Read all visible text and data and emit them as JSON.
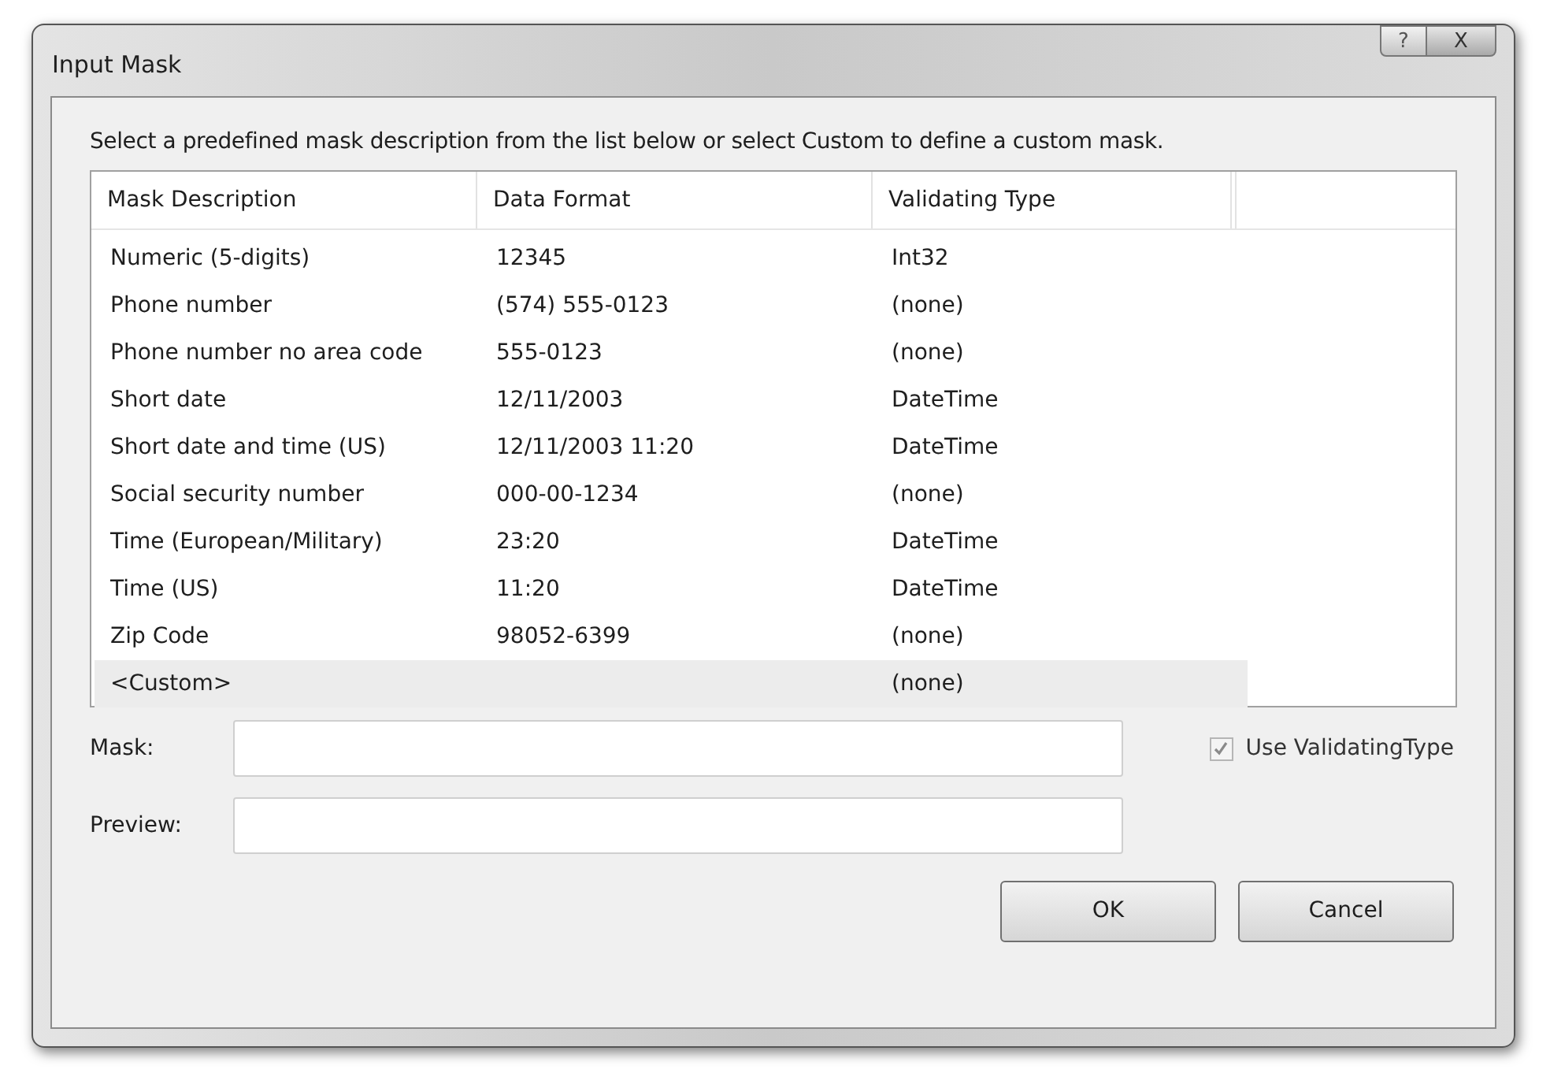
{
  "window": {
    "title": "Input Mask",
    "help_button": "?",
    "close_button": "X"
  },
  "instruction": "Select a predefined mask description from the list below or select Custom to define a custom mask.",
  "table": {
    "columns": [
      "Mask Description",
      "Data Format",
      "Validating Type"
    ],
    "rows": [
      {
        "cells": [
          "Numeric (5-digits)",
          "12345",
          "Int32"
        ],
        "selected": false
      },
      {
        "cells": [
          "Phone number",
          "(574) 555-0123",
          "(none)"
        ],
        "selected": false
      },
      {
        "cells": [
          "Phone number no area code",
          "555-0123",
          "(none)"
        ],
        "selected": false
      },
      {
        "cells": [
          "Short date",
          "12/11/2003",
          "DateTime"
        ],
        "selected": false
      },
      {
        "cells": [
          "Short date and time (US)",
          "12/11/2003 11:20",
          "DateTime"
        ],
        "selected": false
      },
      {
        "cells": [
          "Social security number",
          "000-00-1234",
          "(none)"
        ],
        "selected": false
      },
      {
        "cells": [
          "Time (European/Military)",
          "23:20",
          "DateTime"
        ],
        "selected": false
      },
      {
        "cells": [
          "Time (US)",
          "11:20",
          "DateTime"
        ],
        "selected": false
      },
      {
        "cells": [
          "Zip Code",
          "98052-6399",
          "(none)"
        ],
        "selected": false
      },
      {
        "cells": [
          "<Custom>",
          "",
          "(none)"
        ],
        "selected": true
      }
    ]
  },
  "mask": {
    "label": "Mask:"
  },
  "preview": {
    "label": "Preview:"
  },
  "use_validating_type": {
    "label": "Use ValidatingType",
    "checked": true,
    "disabled": true
  },
  "buttons": [
    "OK",
    "Cancel"
  ]
}
